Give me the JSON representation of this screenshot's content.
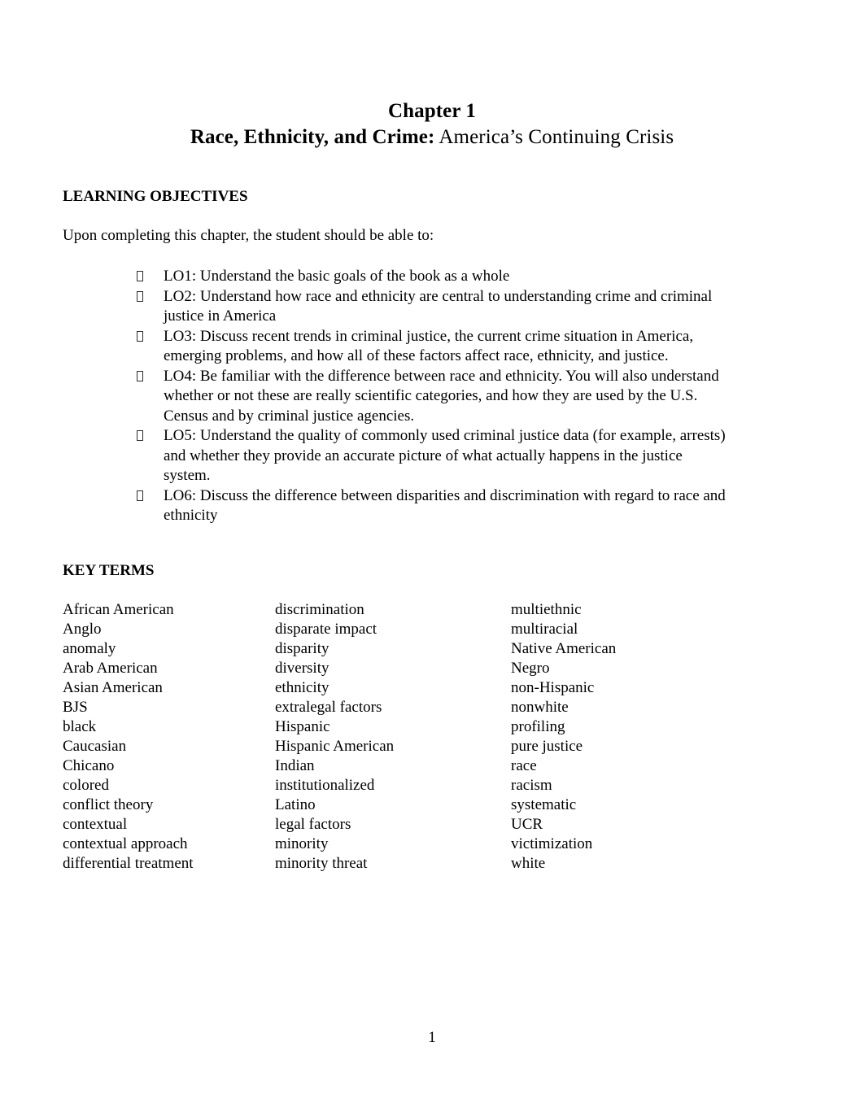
{
  "document": {
    "chapter_label": "Chapter 1",
    "title_bold": "Race, Ethnicity, and Crime:",
    "title_rest": " America’s Continuing Crisis",
    "page_number": "1",
    "bullet_glyph_name": "missing-glyph-box"
  },
  "learning_objectives": {
    "heading": "LEARNING OBJECTIVES",
    "intro": "Upon completing this chapter, the student should be able to:",
    "items": [
      "LO1: Understand the basic goals of the book as a whole",
      "LO2: Understand how race and ethnicity are central to understanding crime and criminal justice in America",
      "LO3: Discuss recent trends in criminal justice, the current crime situation in America, emerging problems, and how all of these factors affect race, ethnicity, and justice.",
      "LO4: Be familiar with the difference between race and ethnicity. You will also understand whether or not these are really scientific categories, and how they are used by the U.S. Census and by criminal justice agencies.",
      "LO5: Understand the quality of commonly used criminal justice data (for example, arrests) and whether they provide an accurate picture of what actually happens in the justice system.",
      "LO6: Discuss the difference between disparities and discrimination with regard to race and ethnicity"
    ]
  },
  "key_terms": {
    "heading": "KEY TERMS",
    "columns": [
      [
        "African American",
        "Anglo",
        "anomaly",
        "Arab American",
        "Asian American",
        "BJS",
        "black",
        "Caucasian",
        "Chicano",
        "colored",
        "conflict theory",
        "contextual",
        "contextual approach",
        "differential treatment"
      ],
      [
        "discrimination",
        "disparate impact",
        "disparity",
        "diversity",
        "ethnicity",
        "extralegal factors",
        "Hispanic",
        "Hispanic American",
        "Indian",
        "institutionalized",
        "Latino",
        "legal factors",
        "minority",
        "minority threat"
      ],
      [
        "multiethnic",
        "multiracial",
        "Native American",
        "Negro",
        "non-Hispanic",
        "nonwhite",
        "profiling",
        "pure justice",
        "race",
        "racism",
        "systematic",
        "UCR",
        "victimization",
        "white"
      ]
    ]
  }
}
